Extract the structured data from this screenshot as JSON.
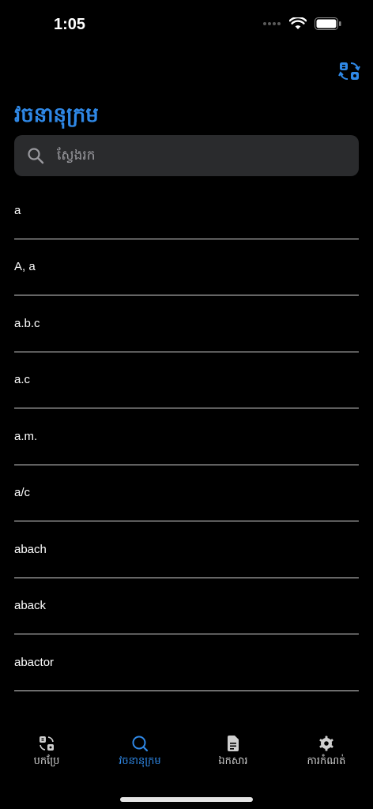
{
  "status_bar": {
    "time": "1:05"
  },
  "header": {
    "title": "វចនានុក្រម"
  },
  "search": {
    "placeholder": "ស្វែងរក"
  },
  "words": [
    "a",
    "A, a",
    "a.b.c",
    "a.c",
    "a.m.",
    "a/c",
    "abach",
    "aback",
    "abactor"
  ],
  "tabs": [
    {
      "label": "បកប្រែ",
      "icon": "translate-icon",
      "active": false
    },
    {
      "label": "វចនានុក្រម",
      "icon": "search-icon",
      "active": true
    },
    {
      "label": "ឯកសារ",
      "icon": "document-icon",
      "active": false
    },
    {
      "label": "ការកំណត់",
      "icon": "gear-icon",
      "active": false
    }
  ],
  "colors": {
    "accent": "#2F88E6",
    "background": "#000000",
    "search_bg": "#2A2B2D"
  }
}
